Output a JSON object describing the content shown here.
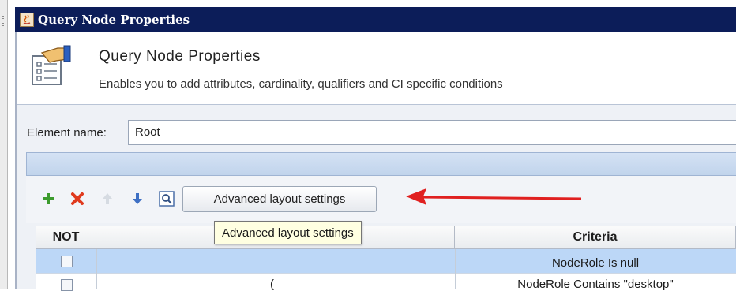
{
  "window": {
    "title": "Query Node Properties"
  },
  "header": {
    "title": "Query Node Properties",
    "description": "Enables you to add attributes, cardinality, qualifiers and CI specific conditions"
  },
  "element_name": {
    "label": "Element name:",
    "value": "Root"
  },
  "toolbar": {
    "icons": [
      "add-icon",
      "delete-icon",
      "move-up-icon",
      "move-down-icon",
      "preview-icon"
    ],
    "advanced_button_label": "Advanced layout settings",
    "tooltip": "Advanced layout settings"
  },
  "table": {
    "headers": {
      "not": "NOT",
      "criteria": "Criteria"
    },
    "rows": [
      {
        "paren": "",
        "criteria": "NodeRole Is null"
      },
      {
        "paren": "(",
        "criteria": "NodeRole Contains \"desktop\""
      }
    ]
  },
  "colors": {
    "titlebar": "#0c1d59",
    "selected_row": "#bcd7f7",
    "annotation_arrow": "#e02020",
    "tooltip_bg": "#ffffe1"
  }
}
